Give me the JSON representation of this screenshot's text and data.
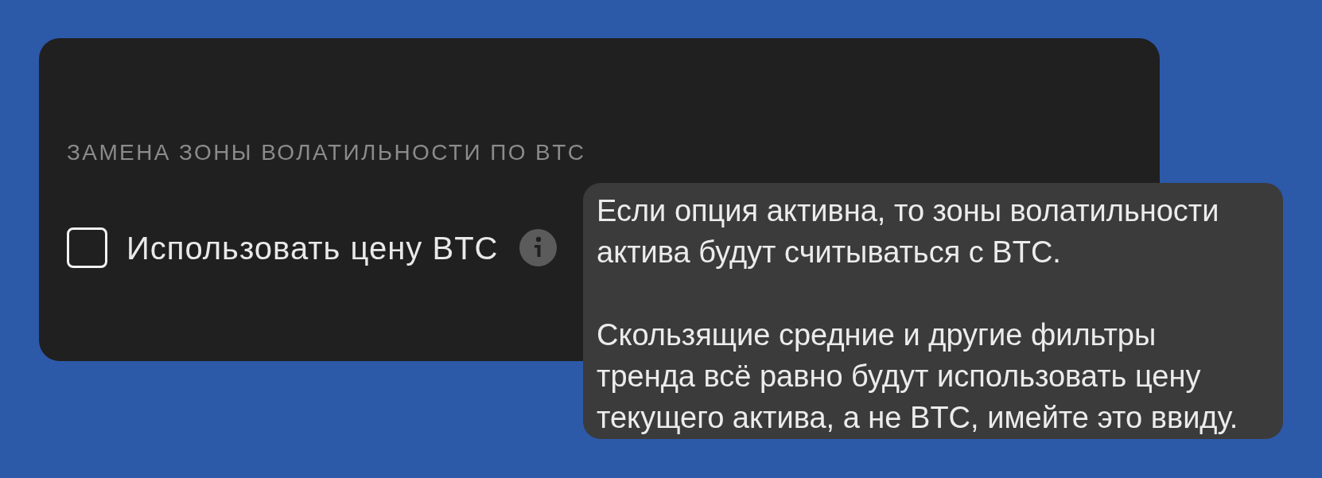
{
  "section": {
    "title": "ЗАМЕНА ЗОНЫ ВОЛАТИЛЬНОСТИ ПО BTC",
    "option": {
      "label": "Использовать цену BTC",
      "checked": false
    }
  },
  "tooltip": {
    "paragraphs": [
      "Если опция активна, то зоны волатильности актива будут считываться с BTC.",
      "Скользящие средние и другие фильтры тренда всё равно будут использовать цену текущего актива, а не BTC, имейте это ввиду."
    ]
  }
}
